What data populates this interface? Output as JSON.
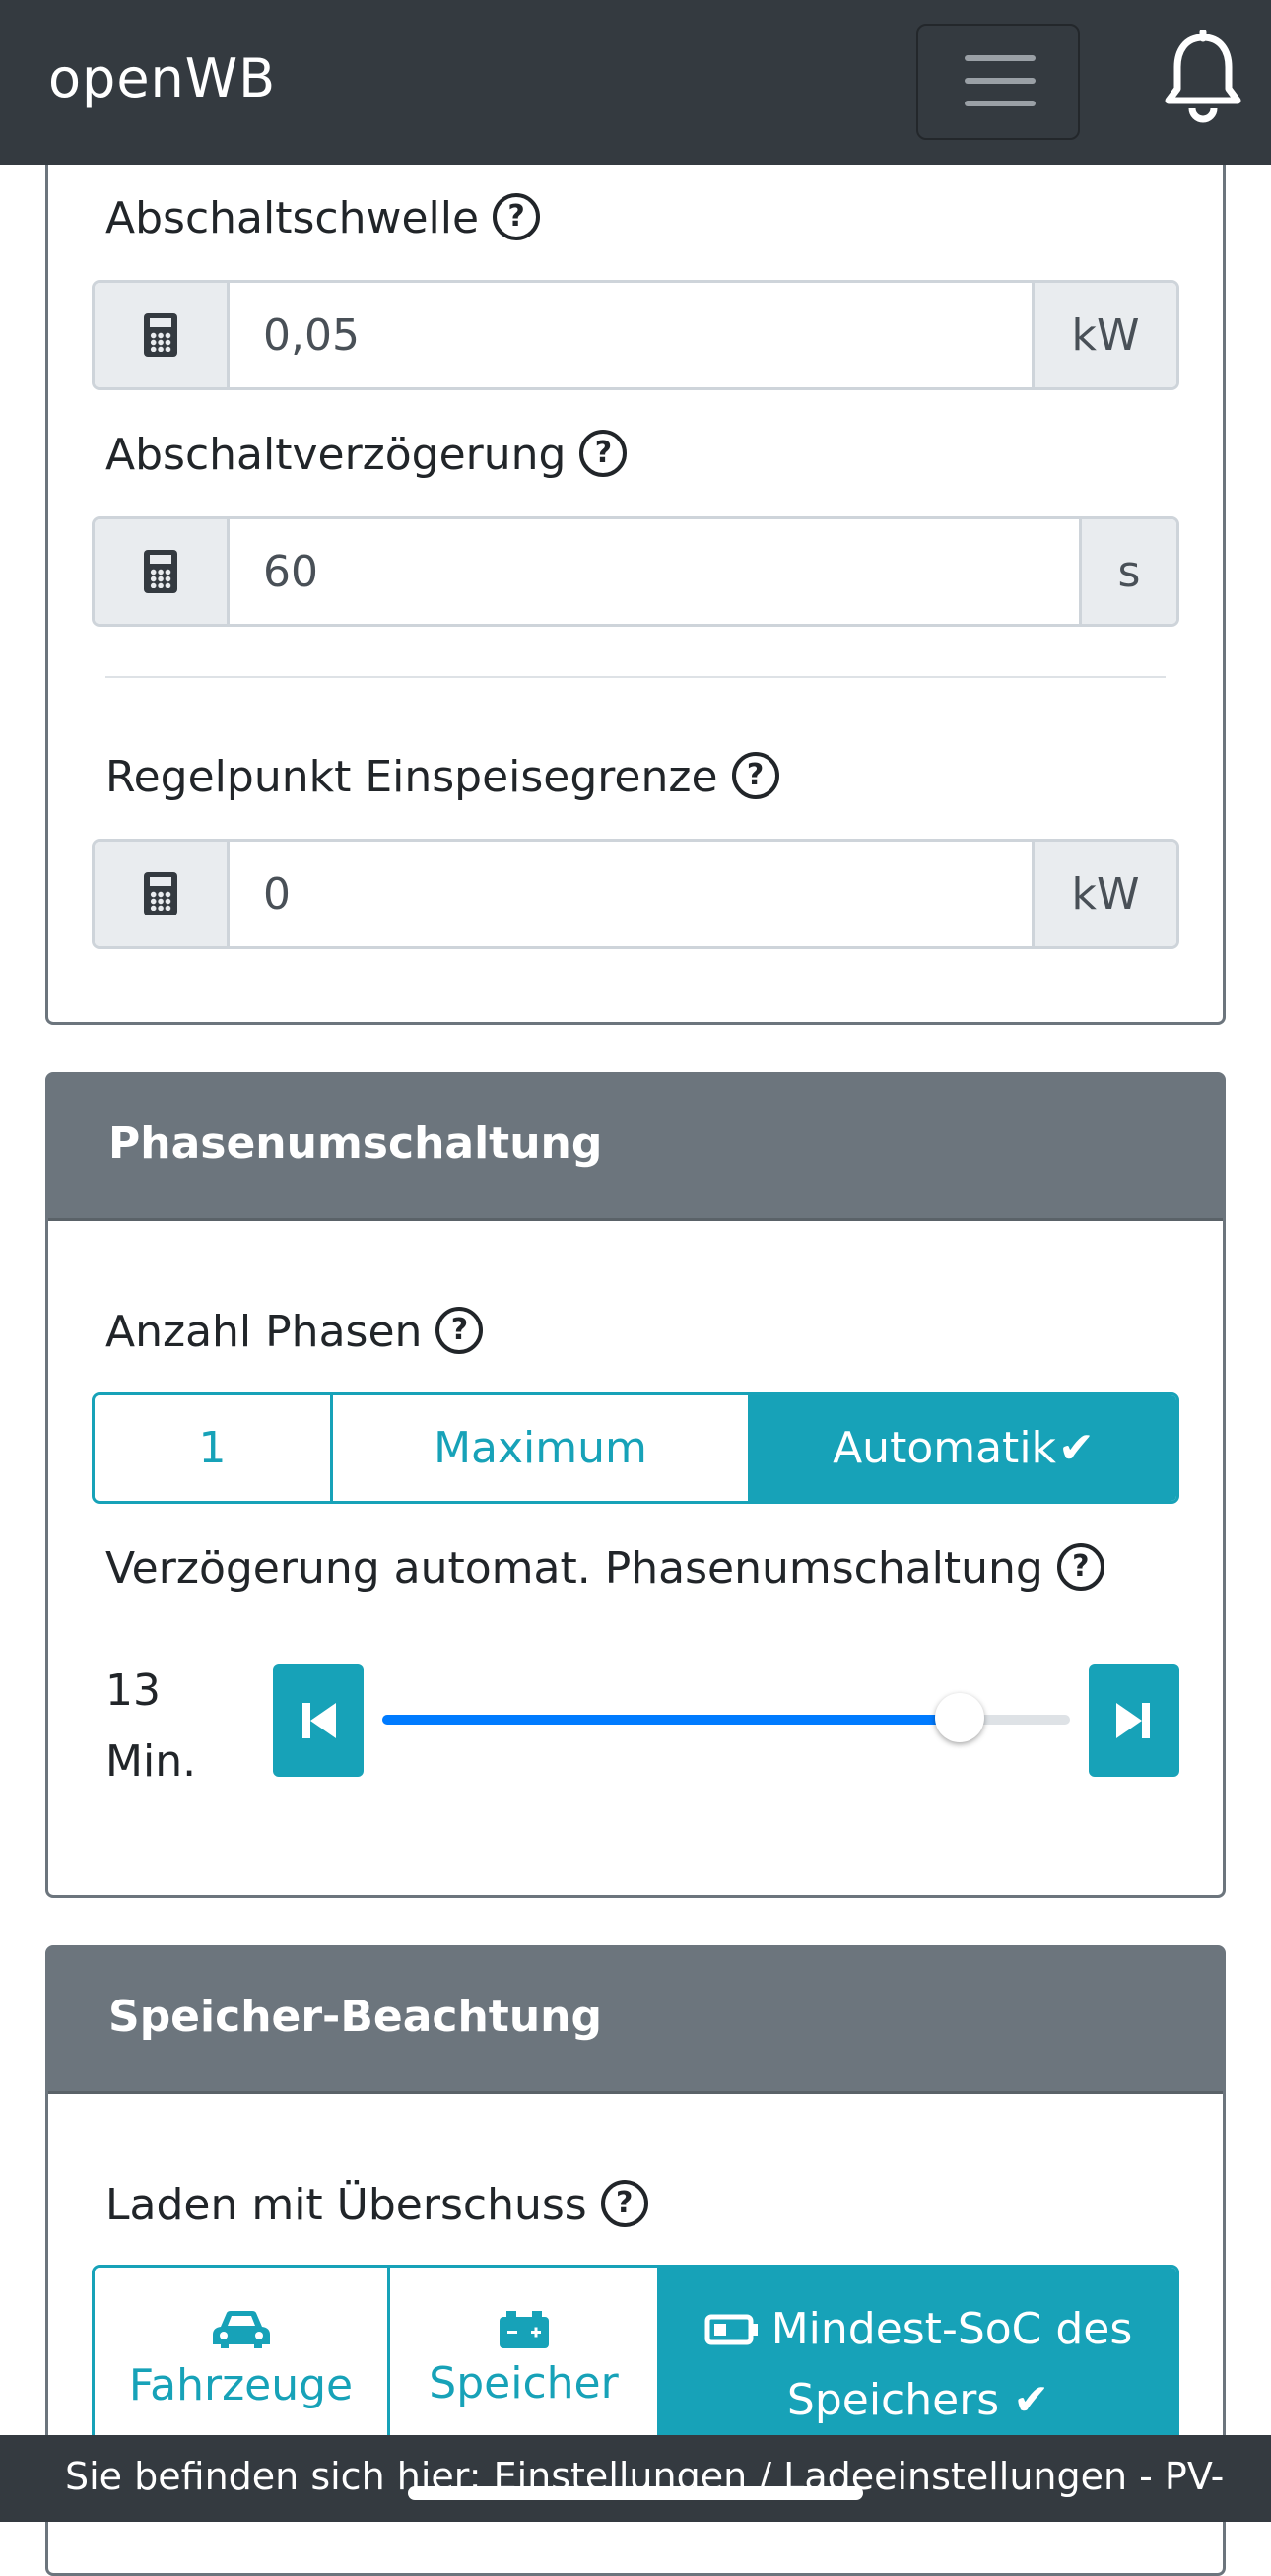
{
  "navbar": {
    "brand": "openWB"
  },
  "pv_section": {
    "abschaltschwelle": {
      "label": "Abschaltschwelle",
      "value": "0,05",
      "unit": "kW"
    },
    "abschaltverzoegerung": {
      "label": "Abschaltverzögerung",
      "value": "60",
      "unit": "s"
    },
    "regelpunkt": {
      "label": "Regelpunkt Einspeisegrenze",
      "value": "0",
      "unit": "kW"
    }
  },
  "phasen": {
    "title": "Phasenumschaltung",
    "anzahl_label": "Anzahl Phasen",
    "options": [
      "1",
      "Maximum",
      "Automatik"
    ],
    "selected": "Automatik",
    "delay_label": "Verzögerung automat. Phasenumschaltung",
    "delay_value": "13",
    "delay_unit": "Min.",
    "slider_fraction": 0.84
  },
  "speicher": {
    "title": "Speicher-Beachtung",
    "laden_label": "Laden mit Überschuss",
    "options": [
      "Fahrzeuge",
      "Speicher",
      "Mindest-SoC des Speichers"
    ],
    "selected": "Mindest-SoC des Speichers"
  },
  "footer": {
    "breadcrumb": "Sie befinden sich hier: Einstellungen / Ladeeinstellungen - PV-"
  },
  "colors": {
    "accent": "#17a2b8",
    "slider": "#007bff",
    "header": "#6c757d",
    "navbar": "#343a40"
  }
}
